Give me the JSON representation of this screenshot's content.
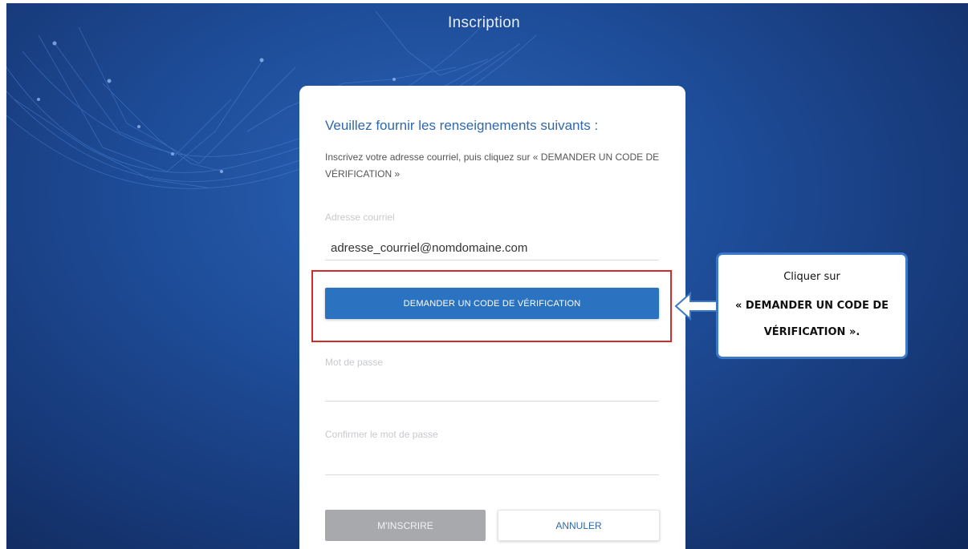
{
  "page": {
    "title": "Inscription"
  },
  "form": {
    "heading": "Veuillez fournir les renseignements suivants :",
    "instructions": "Inscrivez votre adresse courriel, puis cliquez sur « DEMANDER UN CODE DE VÉRIFICATION »",
    "email_label": "Adresse courriel",
    "email_value": "adresse_courriel@nomdomaine.com",
    "verify_button": "DEMANDER UN CODE DE VÉRIFICATION",
    "password_label": "Mot de passe",
    "confirm_password_label": "Confirmer le mot de passe",
    "register_button": "M'INSCRIRE",
    "cancel_button": "ANNULER"
  },
  "callout": {
    "line1": "Cliquer sur",
    "line2": "« DEMANDER UN CODE DE VÉRIFICATION ».",
    "highlight_color": "#d42a2a",
    "border_color": "#3c78c8"
  },
  "colors": {
    "background": "#1f4f9c",
    "primary": "#2b72c0",
    "disabled": "#a7a9ac",
    "heading": "#2f68ad"
  }
}
